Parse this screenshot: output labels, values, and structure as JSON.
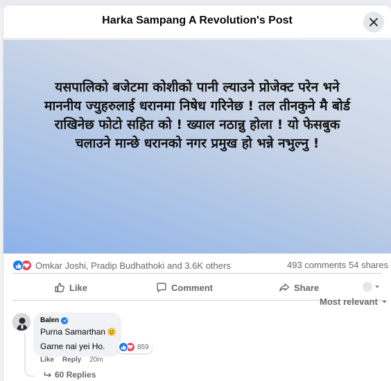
{
  "dialog": {
    "title": "Harka Sampang A Revolution's Post",
    "close_icon": "close-icon"
  },
  "post": {
    "text_lines": [
      "यसपालिको बजेटमा कोशीको पानी ल्याउने प्रोजेक्ट परेन भने",
      "माननीय ज्युहरुलाई धरानमा निषेध गरिनेछ ! तल तीनकुने मै बोर्ड",
      "राखिनेछ फोटो सहित को ! ख्याल नठान्नु होला ! यो फेसबुक",
      "चलाउने मान्छे धरानको नगर प्रमुख हो भन्ने नभुल्नु !"
    ],
    "image_colors": {
      "top": "#dbe3ef",
      "bottom": "#8db2ea"
    }
  },
  "stats": {
    "reactors": "Omkar Joshi, Pradip Budhathoki and 3.6K others",
    "comments": "493 comments",
    "shares": "54 shares",
    "reaction_icons": [
      "like-icon",
      "love-icon"
    ]
  },
  "actions": {
    "like": "Like",
    "comment": "Comment",
    "share": "Share"
  },
  "comments_section": {
    "sort_label": "Most relevant",
    "comment": {
      "author": "Balen",
      "line1": "Purna Samarthan",
      "line2": "Garne nai yei Ho.",
      "reaction_count": "859",
      "like": "Like",
      "reply": "Reply",
      "time": "20m",
      "replies": "60 Replies"
    }
  },
  "colors": {
    "accent": "#1877f2",
    "love": "#f33e58",
    "muted_text": "#65676b"
  }
}
